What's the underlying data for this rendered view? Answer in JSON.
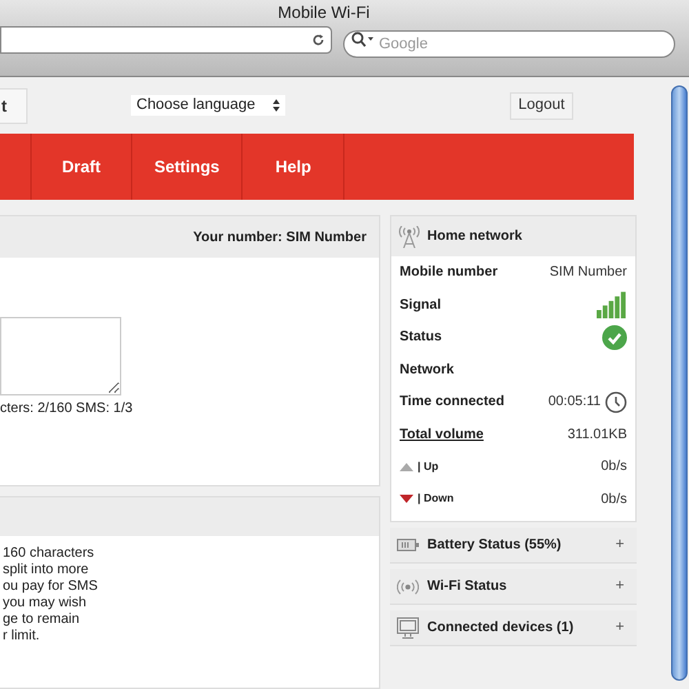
{
  "window": {
    "title": "Mobile Wi-Fi"
  },
  "search": {
    "placeholder": "Google"
  },
  "top": {
    "tab_label": "t",
    "language": "Choose language",
    "logout": "Logout"
  },
  "nav": [
    {
      "label": "Draft",
      "selected": false
    },
    {
      "label": "Settings",
      "selected": false
    },
    {
      "label": "Help",
      "selected": false
    }
  ],
  "message_panel": {
    "your_number": "Your number: SIM Number",
    "counter": "cters: 2/160 SMS: 1/3"
  },
  "info_panel": {
    "lines": [
      "160 characters",
      "split into more",
      "ou pay for SMS",
      "you may wish",
      "ge to remain",
      "r limit."
    ]
  },
  "home_network": {
    "title": "Home network",
    "rows": [
      {
        "kind": "text",
        "label": "Mobile number",
        "value": "SIM Number"
      },
      {
        "kind": "signal",
        "label": "Signal"
      },
      {
        "kind": "status",
        "label": "Status"
      },
      {
        "kind": "text",
        "label": "Network"
      },
      {
        "kind": "time",
        "label": "Time connected",
        "value": "00:05:11"
      },
      {
        "kind": "link",
        "label": "Total volume",
        "value": "311.01KB"
      },
      {
        "kind": "up",
        "label": "| Up",
        "value": "0b/s"
      },
      {
        "kind": "down",
        "label": "| Down",
        "value": "0b/s"
      }
    ]
  },
  "sections": [
    {
      "kind": "battery",
      "title": "Battery Status (55%)",
      "toggle": "+"
    },
    {
      "kind": "wifi",
      "title": "Wi-Fi Status",
      "toggle": "+"
    },
    {
      "kind": "devices",
      "title": "Connected devices (1)",
      "toggle": "+"
    }
  ]
}
